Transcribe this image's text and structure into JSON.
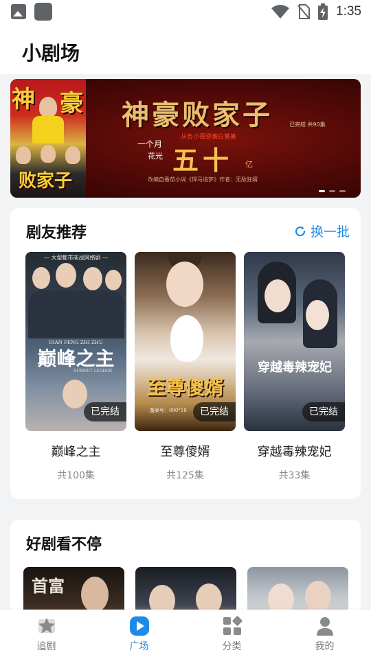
{
  "status_bar": {
    "time": "1:35"
  },
  "header": {
    "title": "小剧场"
  },
  "banner": {
    "title": "神豪败家子",
    "poster_left_chars": [
      "神",
      "豪",
      "败家子"
    ],
    "status": "已完结 共90集",
    "subtitle": "从负小哥逆袭白富美",
    "line_month": "一个月",
    "line_flower": "花光",
    "big_number": "五十",
    "unit": "亿",
    "footer": "改编自番茄小说《悍马追梦》作者：无敌狂婿",
    "dots": 3,
    "active_dot": 0
  },
  "recommend": {
    "title": "剧友推荐",
    "refresh_label": "换一批",
    "items": [
      {
        "poster_top": "— 大型都市商战网络剧 —",
        "poster_cast": "DIAN  FENG  ZHI  ZHU",
        "poster_title": "巅峰之主",
        "poster_sub": "SUMMIT LEADER",
        "badge": "已完结",
        "name": "巅峰之主",
        "count": "共100集"
      },
      {
        "poster_title": "至尊傻婿",
        "poster_note": "备案号：090°18",
        "badge": "已完结",
        "name": "至尊傻婿",
        "count": "共125集"
      },
      {
        "poster_title": "穿越毒辣宠妃",
        "badge": "已完结",
        "name": "穿越毒辣宠妃",
        "count": "共33集"
      }
    ]
  },
  "nonstop": {
    "title": "好剧看不停",
    "posters": [
      {
        "poster_title": "首富"
      },
      {},
      {}
    ]
  },
  "bottom_nav": {
    "items": [
      {
        "label": "追剧",
        "icon": "star-icon",
        "active": false
      },
      {
        "label": "广场",
        "icon": "play-icon",
        "active": true
      },
      {
        "label": "分类",
        "icon": "grid-icon",
        "active": false
      },
      {
        "label": "我的",
        "icon": "person-icon",
        "active": false
      }
    ],
    "active_color": "#1e8ae8",
    "inactive_color": "#777777"
  },
  "colors": {
    "accent": "#1e8ae8",
    "background": "#f2f3f5"
  }
}
